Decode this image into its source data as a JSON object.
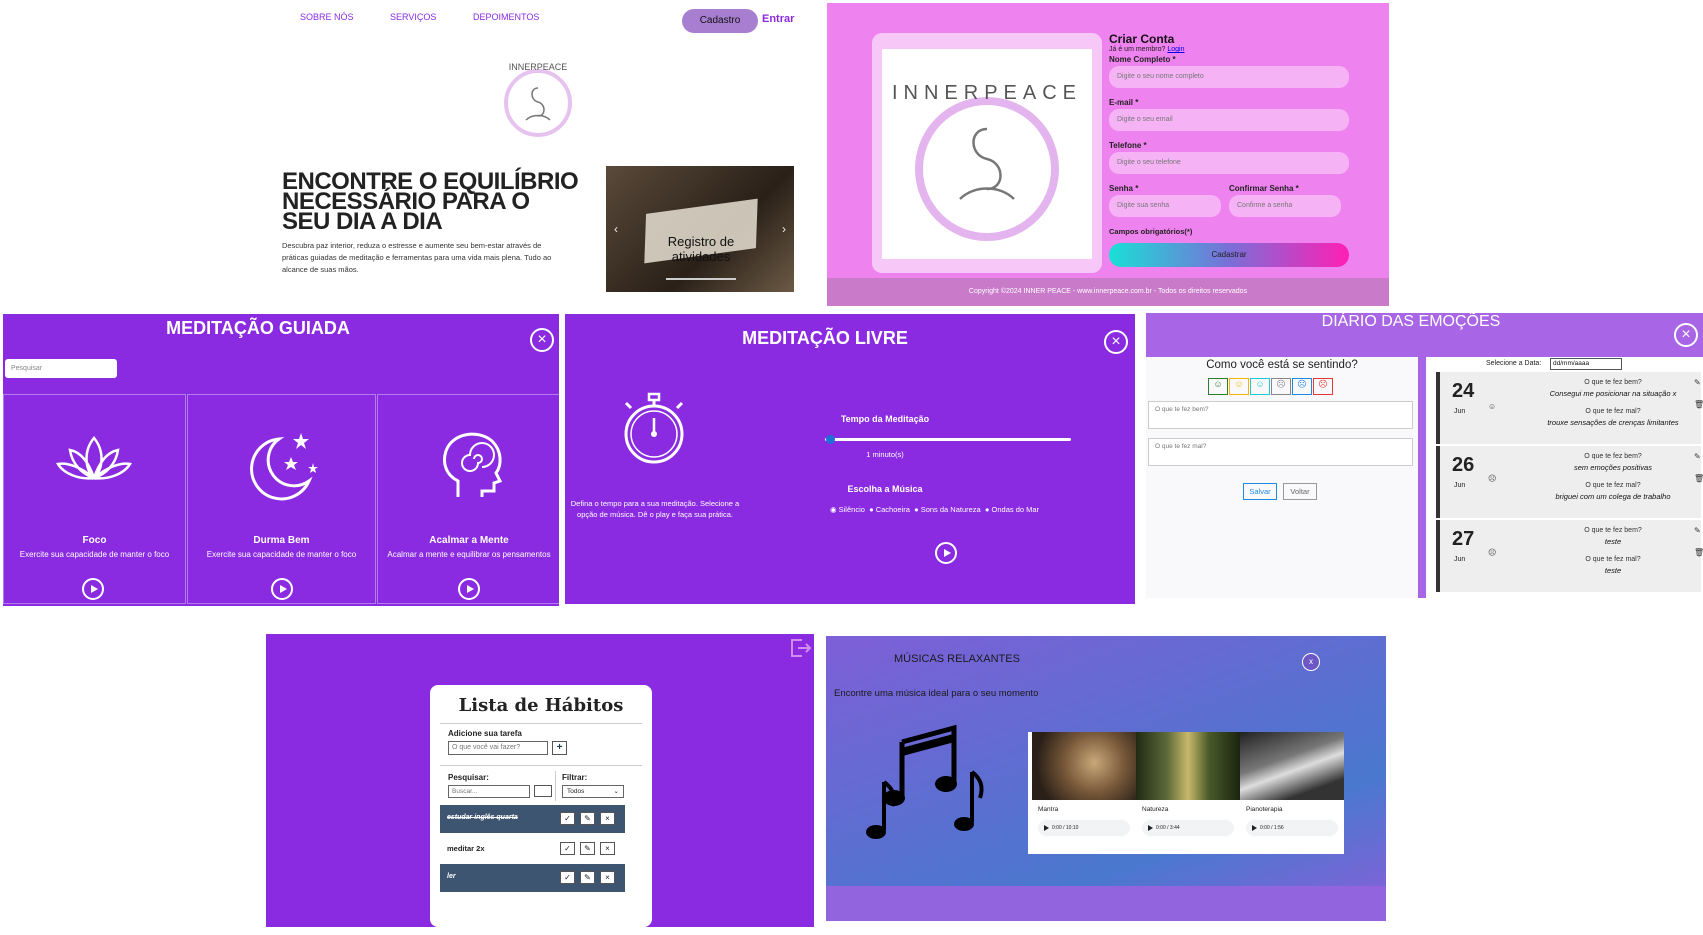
{
  "landing": {
    "nav": [
      "SOBRE NÓS",
      "SERVIÇOS",
      "DEPOIMENTOS"
    ],
    "register_button": "Cadastro",
    "login_link": "Entrar",
    "logo_text": "INNERPEACE",
    "headline": "ENCONTRE O EQUILÍBRIO NECESSÁRIO PARA O SEU DIA A DIA",
    "description": "Descubra paz interior, reduza o estresse e aumente seu bem-estar através de práticas guiadas de meditação e ferramentas para uma vida mais plena. Tudo ao alcance de suas mãos.",
    "carousel_caption": "Registro de atividades"
  },
  "signup": {
    "title": "Criar Conta",
    "member_text": "Já é um membro?",
    "login_link": "Login",
    "fields": [
      {
        "label": "Nome Completo *",
        "placeholder": "Digite o seu nome completo"
      },
      {
        "label": "E-mail *",
        "placeholder": "Digite o seu email"
      },
      {
        "label": "Telefone *",
        "placeholder": "Digite o seu telefone"
      },
      {
        "label": "Senha *",
        "placeholder": "Digite sua senha"
      },
      {
        "label": "Confirmar  Senha *",
        "placeholder": "Confirme a senha"
      }
    ],
    "required_note": "Campos obrigatórios(*)",
    "submit": "Cadastrar",
    "copyright": "Copyright ©2024 INNER PEACE - www.innerpeace.com.br - Todos os direitos reservados"
  },
  "guided": {
    "title": "MEDITAÇÃO GUIADA",
    "search_placeholder": "Pesquisar",
    "cards": [
      {
        "title": "Foco",
        "desc": "Exercite sua capacidade de manter o foco"
      },
      {
        "title": "Durma Bem",
        "desc": "Exercite sua capacidade de manter o foco"
      },
      {
        "title": "Acalmar a Mente",
        "desc": "Acalmar a mente e equilibrar os pensamentos"
      }
    ]
  },
  "free": {
    "title": "MEDITAÇÃO LIVRE",
    "instructions": "Defina o tempo para a sua meditação. Selecione a opção de música. Dê o play e faça sua prática.",
    "time_label": "Tempo da Meditação",
    "time_value": "1 minuto(s)",
    "time_fraction": 0.02,
    "music_label": "Escolha a Música",
    "music_options": [
      "Silêncio",
      "Cachoeira",
      "Sons da Natureza",
      "Ondas do Mar"
    ]
  },
  "diary": {
    "title": "DIÁRIO DAS EMOÇÕES",
    "question": "Como você está se sentindo?",
    "good_placeholder": "O que te fez bem?",
    "bad_placeholder": "O que te fez mal?",
    "save": "Salvar",
    "back": "Voltar",
    "date_label": "Selecione a Data:",
    "date_placeholder": "dd/mm/aaaa",
    "q_good": "O que te fez bem?",
    "q_bad": "O que te fez mal?",
    "entries": [
      {
        "day": "24",
        "month": "Jun",
        "good": "Consegui me posicionar na situação x",
        "bad": "trouxe sensações de crenças limitantes"
      },
      {
        "day": "26",
        "month": "Jun",
        "good": "sem emoções positivas",
        "bad": "briguei com um colega de trabalho"
      },
      {
        "day": "27",
        "month": "Jun",
        "good": "teste",
        "bad": "teste"
      }
    ]
  },
  "habits": {
    "title": "Lista de Hábitos",
    "add_label": "Adicione sua tarefa",
    "add_placeholder": "O que você vai fazer?",
    "search_label": "Pesquisar:",
    "search_placeholder": "Buscar...",
    "filter_label": "Filtrar:",
    "filter_value": "Todos",
    "items": [
      {
        "text": "estudar inglês quarta",
        "done": true
      },
      {
        "text": "meditar 2x",
        "done": false
      },
      {
        "text": "ler",
        "done": true
      }
    ]
  },
  "music": {
    "title": "MÚSICAS RELAXANTES",
    "subtitle": "Encontre uma música ideal para o seu momento",
    "close": "x",
    "tracks": [
      {
        "name": "Mantra",
        "time": "0:00 / 10:10"
      },
      {
        "name": "Natureza",
        "time": "0:00 / 3:44"
      },
      {
        "name": "Pianoterapia",
        "time": "0:00 / 1:56"
      }
    ]
  }
}
